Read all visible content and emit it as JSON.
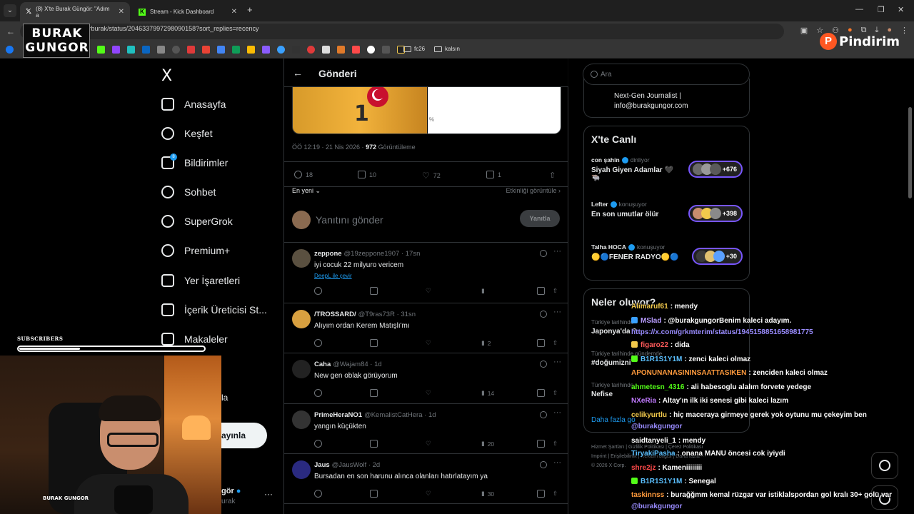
{
  "browser": {
    "tabs": [
      {
        "title": "(8) X'te Burak Güngör: \"Adım a",
        "active": true
      },
      {
        "title": "Stream - Kick Dashboard",
        "active": false
      }
    ],
    "url": "com/gungorburak/status/2046337997298090158?sort_replies=recency",
    "bookmark_folders": [
      "fc26",
      "kalsın"
    ]
  },
  "overlay": {
    "logo_line1": "BURAK",
    "logo_line2": "GUNGOR",
    "sponsor": "Pindirim",
    "sponsor_badge": "P",
    "subscribers_label": "SUBSCRIBERS",
    "subscribers_progress": 0.33,
    "cam_logo": "BURAK GUNGOR"
  },
  "nav": {
    "logo": "X",
    "items": [
      {
        "label": "Anasayfa",
        "icon": "home-icon"
      },
      {
        "label": "Keşfet",
        "icon": "search-icon"
      },
      {
        "label": "Bildirimler",
        "icon": "bell-icon",
        "badge": "8"
      },
      {
        "label": "Sohbet",
        "icon": "chat-icon"
      },
      {
        "label": "SuperGrok",
        "icon": "grok-icon"
      },
      {
        "label": "Premium+",
        "icon": "premium-icon"
      },
      {
        "label": "Yer İşaretleri",
        "icon": "bookmark-icon"
      },
      {
        "label": "İçerik Üreticisi St...",
        "icon": "rocket-icon"
      },
      {
        "label": "Makaleler",
        "icon": "article-icon"
      }
    ],
    "partial_la": "la",
    "post_button": "ayınla",
    "profile_name": "gör",
    "profile_handle": "urak"
  },
  "post": {
    "header_title": "Gönderi",
    "jersey_number": "1",
    "image_caption": "%",
    "time": "ÖÖ 12:19 · 21 Nis 2026 ·",
    "views_count": "972",
    "views_label": "Görüntüleme",
    "stats": {
      "replies": "18",
      "reposts": "10",
      "likes": "72",
      "bookmarks": "1"
    },
    "sort_label": "En yeni",
    "activity_label": "Etkinliği görüntüle",
    "reply_placeholder": "Yanıtını gönder",
    "reply_button": "Yanıtla"
  },
  "replies": [
    {
      "name": "zeppone",
      "handle": "@19zeppone1907 · 17sn",
      "text": "iyi cocuk 22 milyuro vericem",
      "translate": "DeepL ile çevir",
      "views": "",
      "likes": "",
      "avatar_color": "#5a5040"
    },
    {
      "name": "/TROSSARD/",
      "handle": "@T9ras73R · 31sn",
      "text": "Alıyım ordan Kerem Matışlı'mı",
      "translate": "",
      "views": "2",
      "likes": "",
      "avatar_color": "#d8a040"
    },
    {
      "name": "Caha",
      "handle": "@Wajam84 · 1d",
      "text": "New gen oblak görüyorum",
      "translate": "",
      "views": "14",
      "likes": "",
      "avatar_color": "#222222"
    },
    {
      "name": "PrimeHeraNO1",
      "handle": "@KemalistCatHera · 1d",
      "text": "yangın küçükten",
      "translate": "",
      "views": "20",
      "likes": "",
      "avatar_color": "#333333"
    },
    {
      "name": "Jaus",
      "handle": "@JausWolf · 2d",
      "text": "Bursadan en son harunu alınca olanları hatırlatayım ya",
      "translate": "",
      "views": "30",
      "likes": "",
      "avatar_color": "#2a2a80"
    }
  ],
  "right": {
    "search_placeholder": "Ara",
    "bio_line1": "Next-Gen Journalist |",
    "bio_line2": "info@burakgungor.com",
    "live_title": "X'te Canlı",
    "lives": [
      {
        "host": "con şahin",
        "status": "dinliyor",
        "title": "Siyah Giyen Adamlar 🖤",
        "title2": "🐃",
        "count": "+676"
      },
      {
        "host": "Lefter",
        "status": "konuşuyor",
        "title": "En son umutlar ölür",
        "title2": "",
        "count": "+398"
      },
      {
        "host": "Talha HOCA",
        "status": "konuşuyor",
        "title": "🟡🔵FENER RADYO🟡🔵",
        "title2": "",
        "count": "+30"
      }
    ],
    "trends_title": "Neler oluyor?",
    "trends": [
      {
        "context": "Türkiye tarihinde",
        "name": "Japonya'da ?"
      },
      {
        "context": "Türkiye tarihinde gündemde",
        "name": "#doğumizni"
      },
      {
        "context": "Türkiye tarihinde",
        "name": "Nefise"
      }
    ],
    "trends_more": "Daha fazla gö",
    "footer_line1": "Hizmet Şartları  |  Gizlilik Politikası  |  Çerez Politikası",
    "footer_line2": "Imprint  |  Erişilebilirlik  |  Reklam bilgisi  |  Daha fazla ···",
    "footer_line3": "© 2026 X Corp."
  },
  "chat": [
    {
      "user": "Alimaruf61",
      "color": "#f2c94c",
      "text": ": mendy",
      "badge": ""
    },
    {
      "user": "MSlad",
      "color": "#b89cff",
      "text": ": @burakgungorBenim kaleci adayım.",
      "badge": "#3aa0ff"
    },
    {
      "user": "",
      "color": "#9a8cff",
      "text": "https://x.com/grkmterim/status/1945158851658981775",
      "badge": ""
    },
    {
      "user": "figaro22",
      "color": "#ff5a5a",
      "text": ": dida",
      "badge": "#f2c94c"
    },
    {
      "user": "B1R1S1Y1M",
      "color": "#5bc0ff",
      "text": ": zenci kaleci olmaz",
      "badge": "#53fc18"
    },
    {
      "user": "APONUNANASININSAATTASIKEN",
      "color": "#ff9a3c",
      "text": ": zenciden kaleci olmaz",
      "badge": ""
    },
    {
      "user": "ahmetesn_4316",
      "color": "#53fc18",
      "text": ": ali habesoglu alalım forvete yedege",
      "badge": ""
    },
    {
      "user": "NXeRia",
      "color": "#c07aff",
      "text": ": Altay'ın ilk iki senesi gibi kaleci lazım",
      "badge": ""
    },
    {
      "user": "celikyurtlu",
      "color": "#f2c94c",
      "text": ": hiç maceraya girmeye gerek yok oytunu mu çekeyim ben",
      "badge": ""
    },
    {
      "user": "",
      "color": "#9a8cff",
      "text": "@burakgungor",
      "badge": ""
    },
    {
      "user": "saidtanyeli_1",
      "color": "#ffffff",
      "text": ": mendy",
      "badge": ""
    },
    {
      "user": "TiryakiPasha",
      "color": "#5bc0ff",
      "text": ": onana MANU öncesi cok iyiydi",
      "badge": ""
    },
    {
      "user": "shre2jz",
      "color": "#ff4a4a",
      "text": ": Kameniiiiiiii",
      "badge": ""
    },
    {
      "user": "B1R1S1Y1M",
      "color": "#5bc0ff",
      "text": ": Senegal",
      "badge": "#53fc18"
    },
    {
      "user": "taskinnss",
      "color": "#ff9a3c",
      "text": ": buraǧǧmm kemal rüzgar var istiklalspordan gol kralı 30+ golü var",
      "badge": ""
    },
    {
      "user": "",
      "color": "#9a8cff",
      "text": "@burakgungor",
      "badge": ""
    }
  ]
}
